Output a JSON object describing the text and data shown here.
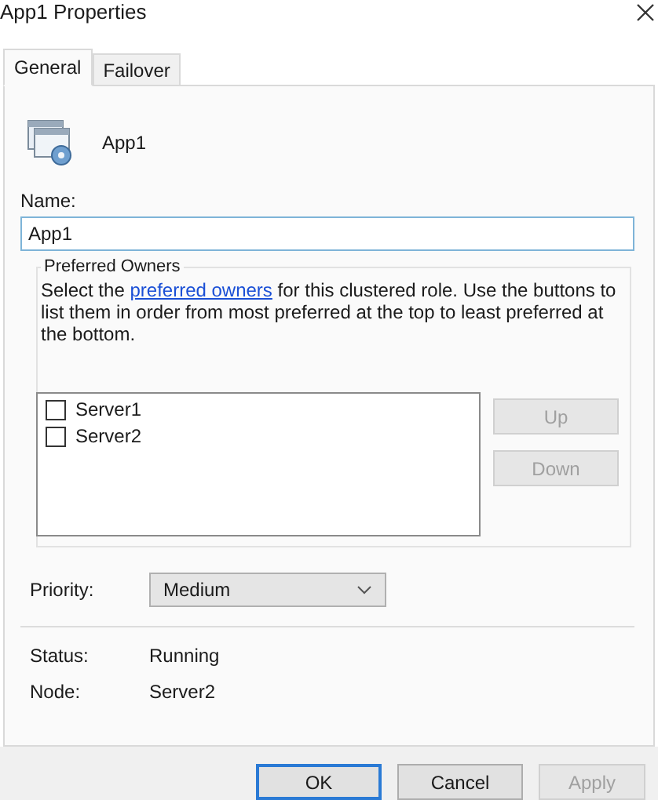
{
  "window": {
    "title": "App1 Properties"
  },
  "tabs": [
    {
      "label": "General",
      "selected": true
    },
    {
      "label": "Failover",
      "selected": false
    }
  ],
  "role": {
    "name": "App1"
  },
  "name_field": {
    "label": "Name:",
    "value": "App1"
  },
  "preferred_owners": {
    "title": "Preferred Owners",
    "description_before": "Select the",
    "link": "preferred owners",
    "description_after": "for this clustered role. Use the buttons to list them in order from most preferred at the top to least preferred at the bottom.",
    "owners": [
      {
        "name": "Server1",
        "checked": false
      },
      {
        "name": "Server2",
        "checked": false
      }
    ],
    "buttons": [
      {
        "label": "Up",
        "disabled": true
      },
      {
        "label": "Down",
        "disabled": true
      }
    ]
  },
  "priority": {
    "label": "Priority:",
    "value": "Medium"
  },
  "info": [
    {
      "label": "Status:",
      "value": "Running"
    },
    {
      "label": "Node:",
      "value": "Server2"
    }
  ],
  "buttons": [
    {
      "label": "OK",
      "default": true,
      "disabled": false
    },
    {
      "label": "Cancel",
      "default": false,
      "disabled": false
    },
    {
      "label": "Apply",
      "default": false,
      "disabled": true
    }
  ]
}
